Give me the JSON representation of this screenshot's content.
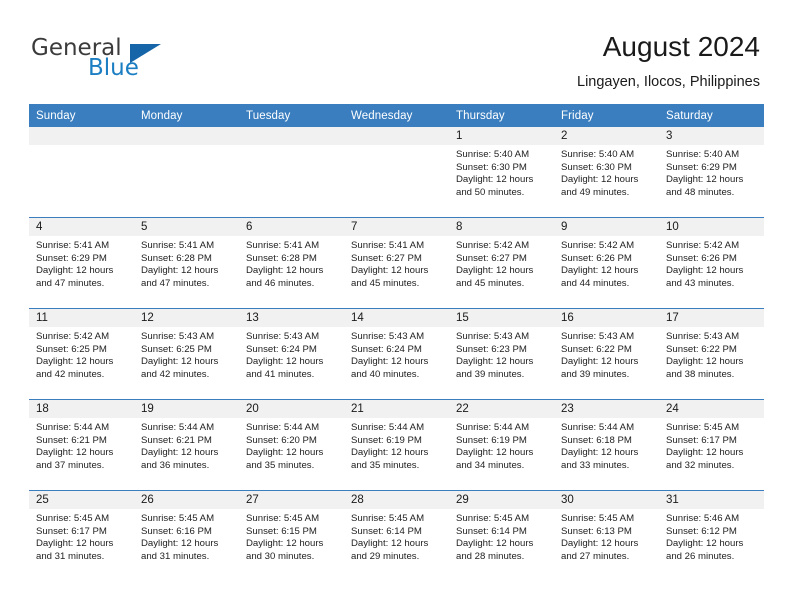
{
  "brand": {
    "line1": "General",
    "line2": "Blue",
    "mark": "triangle-logo",
    "accent": "#1b7ec2"
  },
  "header": {
    "title": "August 2024",
    "subtitle": "Lingayen, Ilocos, Philippines"
  },
  "theme": {
    "header_bg": "#3a7ebf",
    "daynum_bg": "#f1f1f1",
    "grid_line": "#3a7ebf"
  },
  "weekday_headers": [
    "Sunday",
    "Monday",
    "Tuesday",
    "Wednesday",
    "Thursday",
    "Friday",
    "Saturday"
  ],
  "weeks": [
    [
      {
        "day": "",
        "sunrise": "",
        "sunset": "",
        "daylight1": "",
        "daylight2": ""
      },
      {
        "day": "",
        "sunrise": "",
        "sunset": "",
        "daylight1": "",
        "daylight2": ""
      },
      {
        "day": "",
        "sunrise": "",
        "sunset": "",
        "daylight1": "",
        "daylight2": ""
      },
      {
        "day": "",
        "sunrise": "",
        "sunset": "",
        "daylight1": "",
        "daylight2": ""
      },
      {
        "day": "1",
        "sunrise": "Sunrise: 5:40 AM",
        "sunset": "Sunset: 6:30 PM",
        "daylight1": "Daylight: 12 hours",
        "daylight2": "and 50 minutes."
      },
      {
        "day": "2",
        "sunrise": "Sunrise: 5:40 AM",
        "sunset": "Sunset: 6:30 PM",
        "daylight1": "Daylight: 12 hours",
        "daylight2": "and 49 minutes."
      },
      {
        "day": "3",
        "sunrise": "Sunrise: 5:40 AM",
        "sunset": "Sunset: 6:29 PM",
        "daylight1": "Daylight: 12 hours",
        "daylight2": "and 48 minutes."
      }
    ],
    [
      {
        "day": "4",
        "sunrise": "Sunrise: 5:41 AM",
        "sunset": "Sunset: 6:29 PM",
        "daylight1": "Daylight: 12 hours",
        "daylight2": "and 47 minutes."
      },
      {
        "day": "5",
        "sunrise": "Sunrise: 5:41 AM",
        "sunset": "Sunset: 6:28 PM",
        "daylight1": "Daylight: 12 hours",
        "daylight2": "and 47 minutes."
      },
      {
        "day": "6",
        "sunrise": "Sunrise: 5:41 AM",
        "sunset": "Sunset: 6:28 PM",
        "daylight1": "Daylight: 12 hours",
        "daylight2": "and 46 minutes."
      },
      {
        "day": "7",
        "sunrise": "Sunrise: 5:41 AM",
        "sunset": "Sunset: 6:27 PM",
        "daylight1": "Daylight: 12 hours",
        "daylight2": "and 45 minutes."
      },
      {
        "day": "8",
        "sunrise": "Sunrise: 5:42 AM",
        "sunset": "Sunset: 6:27 PM",
        "daylight1": "Daylight: 12 hours",
        "daylight2": "and 45 minutes."
      },
      {
        "day": "9",
        "sunrise": "Sunrise: 5:42 AM",
        "sunset": "Sunset: 6:26 PM",
        "daylight1": "Daylight: 12 hours",
        "daylight2": "and 44 minutes."
      },
      {
        "day": "10",
        "sunrise": "Sunrise: 5:42 AM",
        "sunset": "Sunset: 6:26 PM",
        "daylight1": "Daylight: 12 hours",
        "daylight2": "and 43 minutes."
      }
    ],
    [
      {
        "day": "11",
        "sunrise": "Sunrise: 5:42 AM",
        "sunset": "Sunset: 6:25 PM",
        "daylight1": "Daylight: 12 hours",
        "daylight2": "and 42 minutes."
      },
      {
        "day": "12",
        "sunrise": "Sunrise: 5:43 AM",
        "sunset": "Sunset: 6:25 PM",
        "daylight1": "Daylight: 12 hours",
        "daylight2": "and 42 minutes."
      },
      {
        "day": "13",
        "sunrise": "Sunrise: 5:43 AM",
        "sunset": "Sunset: 6:24 PM",
        "daylight1": "Daylight: 12 hours",
        "daylight2": "and 41 minutes."
      },
      {
        "day": "14",
        "sunrise": "Sunrise: 5:43 AM",
        "sunset": "Sunset: 6:24 PM",
        "daylight1": "Daylight: 12 hours",
        "daylight2": "and 40 minutes."
      },
      {
        "day": "15",
        "sunrise": "Sunrise: 5:43 AM",
        "sunset": "Sunset: 6:23 PM",
        "daylight1": "Daylight: 12 hours",
        "daylight2": "and 39 minutes."
      },
      {
        "day": "16",
        "sunrise": "Sunrise: 5:43 AM",
        "sunset": "Sunset: 6:22 PM",
        "daylight1": "Daylight: 12 hours",
        "daylight2": "and 39 minutes."
      },
      {
        "day": "17",
        "sunrise": "Sunrise: 5:43 AM",
        "sunset": "Sunset: 6:22 PM",
        "daylight1": "Daylight: 12 hours",
        "daylight2": "and 38 minutes."
      }
    ],
    [
      {
        "day": "18",
        "sunrise": "Sunrise: 5:44 AM",
        "sunset": "Sunset: 6:21 PM",
        "daylight1": "Daylight: 12 hours",
        "daylight2": "and 37 minutes."
      },
      {
        "day": "19",
        "sunrise": "Sunrise: 5:44 AM",
        "sunset": "Sunset: 6:21 PM",
        "daylight1": "Daylight: 12 hours",
        "daylight2": "and 36 minutes."
      },
      {
        "day": "20",
        "sunrise": "Sunrise: 5:44 AM",
        "sunset": "Sunset: 6:20 PM",
        "daylight1": "Daylight: 12 hours",
        "daylight2": "and 35 minutes."
      },
      {
        "day": "21",
        "sunrise": "Sunrise: 5:44 AM",
        "sunset": "Sunset: 6:19 PM",
        "daylight1": "Daylight: 12 hours",
        "daylight2": "and 35 minutes."
      },
      {
        "day": "22",
        "sunrise": "Sunrise: 5:44 AM",
        "sunset": "Sunset: 6:19 PM",
        "daylight1": "Daylight: 12 hours",
        "daylight2": "and 34 minutes."
      },
      {
        "day": "23",
        "sunrise": "Sunrise: 5:44 AM",
        "sunset": "Sunset: 6:18 PM",
        "daylight1": "Daylight: 12 hours",
        "daylight2": "and 33 minutes."
      },
      {
        "day": "24",
        "sunrise": "Sunrise: 5:45 AM",
        "sunset": "Sunset: 6:17 PM",
        "daylight1": "Daylight: 12 hours",
        "daylight2": "and 32 minutes."
      }
    ],
    [
      {
        "day": "25",
        "sunrise": "Sunrise: 5:45 AM",
        "sunset": "Sunset: 6:17 PM",
        "daylight1": "Daylight: 12 hours",
        "daylight2": "and 31 minutes."
      },
      {
        "day": "26",
        "sunrise": "Sunrise: 5:45 AM",
        "sunset": "Sunset: 6:16 PM",
        "daylight1": "Daylight: 12 hours",
        "daylight2": "and 31 minutes."
      },
      {
        "day": "27",
        "sunrise": "Sunrise: 5:45 AM",
        "sunset": "Sunset: 6:15 PM",
        "daylight1": "Daylight: 12 hours",
        "daylight2": "and 30 minutes."
      },
      {
        "day": "28",
        "sunrise": "Sunrise: 5:45 AM",
        "sunset": "Sunset: 6:14 PM",
        "daylight1": "Daylight: 12 hours",
        "daylight2": "and 29 minutes."
      },
      {
        "day": "29",
        "sunrise": "Sunrise: 5:45 AM",
        "sunset": "Sunset: 6:14 PM",
        "daylight1": "Daylight: 12 hours",
        "daylight2": "and 28 minutes."
      },
      {
        "day": "30",
        "sunrise": "Sunrise: 5:45 AM",
        "sunset": "Sunset: 6:13 PM",
        "daylight1": "Daylight: 12 hours",
        "daylight2": "and 27 minutes."
      },
      {
        "day": "31",
        "sunrise": "Sunrise: 5:46 AM",
        "sunset": "Sunset: 6:12 PM",
        "daylight1": "Daylight: 12 hours",
        "daylight2": "and 26 minutes."
      }
    ]
  ]
}
